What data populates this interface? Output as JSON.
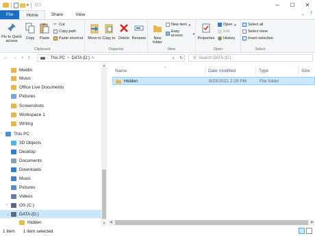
{
  "window": {
    "title": "D:\\",
    "controls": {
      "minimize": "─",
      "maximize": "☐",
      "close": "✕"
    }
  },
  "quick_access_toolbar": {
    "arrow": "▾"
  },
  "ribbon_tabs": [
    {
      "label": "File"
    },
    {
      "label": "Home"
    },
    {
      "label": "Share"
    },
    {
      "label": "View"
    }
  ],
  "ribbon_tabs_right": {
    "collapse": "⌄",
    "help": "?"
  },
  "ribbon": {
    "clipboard": {
      "group_label": "Clipboard",
      "pin_label": "Pin to Quick access",
      "copy_label": "Copy",
      "paste_label": "Paste",
      "cut_label": "Cut",
      "copy_path_label": "Copy path",
      "paste_shortcut_label": "Paste shortcut"
    },
    "organize": {
      "group_label": "Organize",
      "move_to_label": "Move to",
      "copy_to_label": "Copy to",
      "delete_label": "Delete",
      "rename_label": "Rename"
    },
    "new": {
      "group_label": "New",
      "new_folder_label": "New folder",
      "new_item_label": "New item",
      "easy_access_label": "Easy access"
    },
    "open": {
      "group_label": "Open",
      "properties_label": "Properties",
      "open_label": "Open",
      "edit_label": "Edit",
      "history_label": "History"
    },
    "select": {
      "group_label": "Select",
      "select_all_label": "Select all",
      "select_none_label": "Select none",
      "invert_label": "Invert selection"
    }
  },
  "navigation": {
    "back": "←",
    "forward": "→",
    "recent": "∨",
    "up": "↑"
  },
  "address_bar": {
    "crumbs": [
      "This PC",
      ">",
      "DATA (D:)",
      ">"
    ],
    "dropdown": "∨",
    "refresh": "↻"
  },
  "search": {
    "placeholder": "Search DATA (D:)",
    "icon": "⚲"
  },
  "nav_pane": {
    "items": [
      {
        "label": "Medlin",
        "icon": "folder-icon",
        "color": "#e8b84a"
      },
      {
        "label": "Music",
        "icon": "folder-icon",
        "color": "#e8b84a"
      },
      {
        "label": "Office Live Documents",
        "icon": "folder-icon",
        "color": "#e8b84a"
      },
      {
        "label": "Pictures",
        "icon": "pictures-folder-icon",
        "color": "#7aa6d6"
      },
      {
        "label": "Screenshots",
        "icon": "folder-icon",
        "color": "#e8b84a"
      },
      {
        "label": "Workspace 1",
        "icon": "folder-icon",
        "color": "#e8b84a"
      },
      {
        "label": "Writing",
        "icon": "folder-icon",
        "color": "#e8b84a"
      },
      {
        "label": "This PC",
        "icon": "computer-icon",
        "color": "#4a90d9"
      },
      {
        "label": "3D Objects",
        "icon": "3d-objects-icon",
        "color": "#4fb3e6"
      },
      {
        "label": "Desktop",
        "icon": "desktop-icon",
        "color": "#2d7fd3"
      },
      {
        "label": "Documents",
        "icon": "documents-icon",
        "color": "#8aa0b8"
      },
      {
        "label": "Downloads",
        "icon": "downloads-icon",
        "color": "#2d7fd3"
      },
      {
        "label": "Music",
        "icon": "music-icon",
        "color": "#4a7fc0"
      },
      {
        "label": "Pictures",
        "icon": "pictures-icon",
        "color": "#5a8fc8"
      },
      {
        "label": "Videos",
        "icon": "videos-icon",
        "color": "#6a7fa8"
      },
      {
        "label": "OS (C:)",
        "icon": "drive-icon",
        "color": "#5a6a80"
      },
      {
        "label": "DATA (D:)",
        "icon": "drive-icon",
        "color": "#5a6a80",
        "selected": true
      },
      {
        "label": "Hidden",
        "icon": "folder-icon",
        "color": "#e8b84a"
      }
    ]
  },
  "file_list": {
    "columns": [
      "Name",
      "Date modified",
      "Type",
      "Size"
    ],
    "sort_indicator": "^",
    "rows": [
      {
        "name": "Hidden",
        "date_modified": "8/23/2021 2:29 PM",
        "type": "File folder",
        "size": ""
      }
    ]
  },
  "status_bar": {
    "item_count": "1 item",
    "selection": "1 item selected"
  }
}
